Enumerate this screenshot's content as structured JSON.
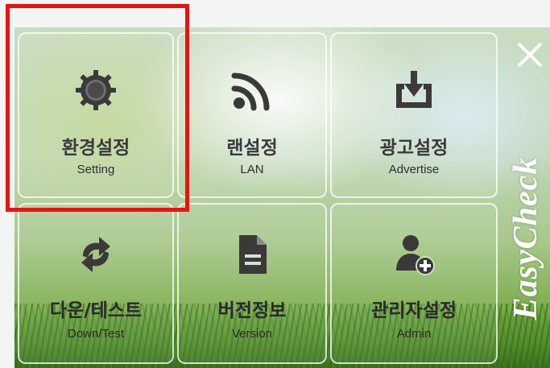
{
  "menu": {
    "tiles": [
      {
        "id": "setting",
        "label_ko": "환경설정",
        "label_en": "Setting",
        "icon": "gear-icon"
      },
      {
        "id": "lan",
        "label_ko": "랜설정",
        "label_en": "LAN",
        "icon": "rss-feed-icon"
      },
      {
        "id": "advertise",
        "label_ko": "광고설정",
        "label_en": "Advertise",
        "icon": "download-tray-icon"
      },
      {
        "id": "download-test",
        "label_ko": "다운/테스트",
        "label_en": "Down/Test",
        "icon": "refresh-arrows-icon"
      },
      {
        "id": "version",
        "label_ko": "버전정보",
        "label_en": "Version",
        "icon": "document-icon"
      },
      {
        "id": "admin",
        "label_ko": "관리자설정",
        "label_en": "Admin",
        "icon": "add-user-icon"
      }
    ]
  },
  "close": {
    "icon": "close-icon",
    "glyph": "×"
  },
  "brand": {
    "text": "EasyCheck"
  },
  "highlight": {
    "target": "setting",
    "color": "#ee1010"
  },
  "colors": {
    "icon": "#3a3a3a",
    "tile_border": "#ffffff"
  }
}
